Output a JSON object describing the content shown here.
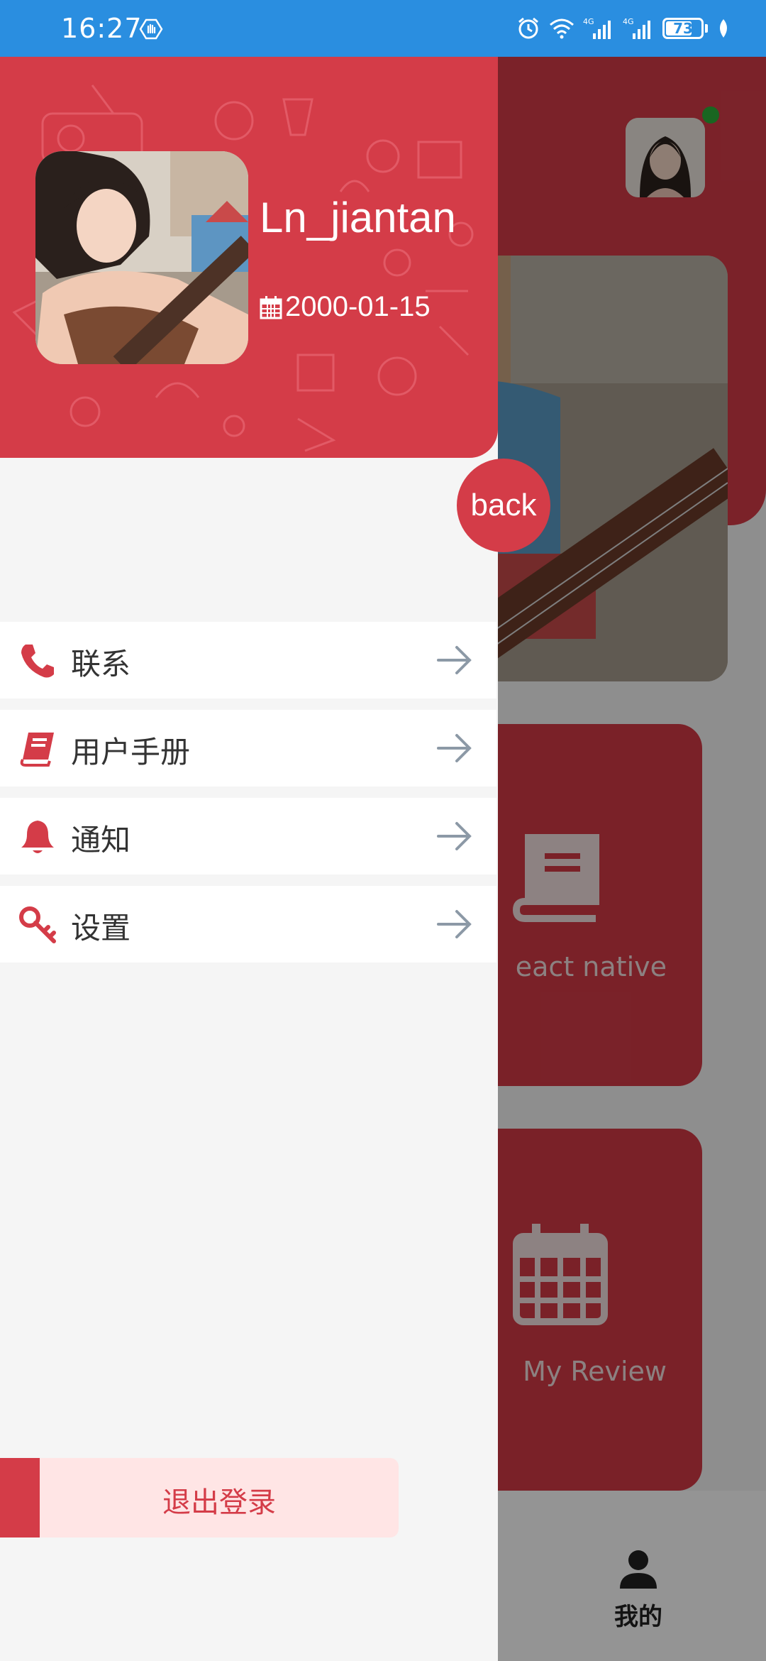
{
  "status_bar": {
    "time": "16:27",
    "battery": "73",
    "network_label": "4G"
  },
  "drawer": {
    "username": "Ln_jiantan",
    "birthday": "2000-01-15",
    "back_label": "back",
    "menu": [
      {
        "label": "联系",
        "icon": "phone-icon"
      },
      {
        "label": "用户手册",
        "icon": "book-icon"
      },
      {
        "label": "通知",
        "icon": "bell-icon"
      },
      {
        "label": "设置",
        "icon": "key-icon"
      }
    ],
    "logout_label": "退出登录"
  },
  "background": {
    "card1_label": "eact native",
    "card2_label": "My Review",
    "tab_label": "我的"
  },
  "colors": {
    "accent": "#d43c48",
    "status_bar": "#2a8ee0",
    "logout_bg": "#ffe5e5"
  }
}
